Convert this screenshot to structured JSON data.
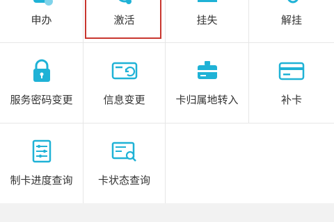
{
  "colors": {
    "icon_teal": "#1fb2d6",
    "icon_teal_light": "#7fd3ea",
    "highlight_red": "#c8352e",
    "text": "#333333",
    "divider": "#e6e6e6"
  },
  "menu": {
    "row1": {
      "apply": {
        "label": "申办"
      },
      "activate": {
        "label": "激活"
      },
      "report_loss": {
        "label": "挂失"
      },
      "cancel_loss": {
        "label": "解挂"
      }
    },
    "row2": {
      "password_change": {
        "label": "服务密码变更",
        "icon": "padlock-icon"
      },
      "info_change": {
        "label": "信息变更",
        "icon": "card-refresh-icon"
      },
      "transfer_in": {
        "label": "卡归属地转入",
        "icon": "card-transfer-icon"
      },
      "reissue": {
        "label": "补卡",
        "icon": "card-icon"
      }
    },
    "row3": {
      "progress_query": {
        "label": "制卡进度查询",
        "icon": "progress-list-icon"
      },
      "status_query": {
        "label": "卡状态查询",
        "icon": "card-search-icon"
      }
    }
  }
}
